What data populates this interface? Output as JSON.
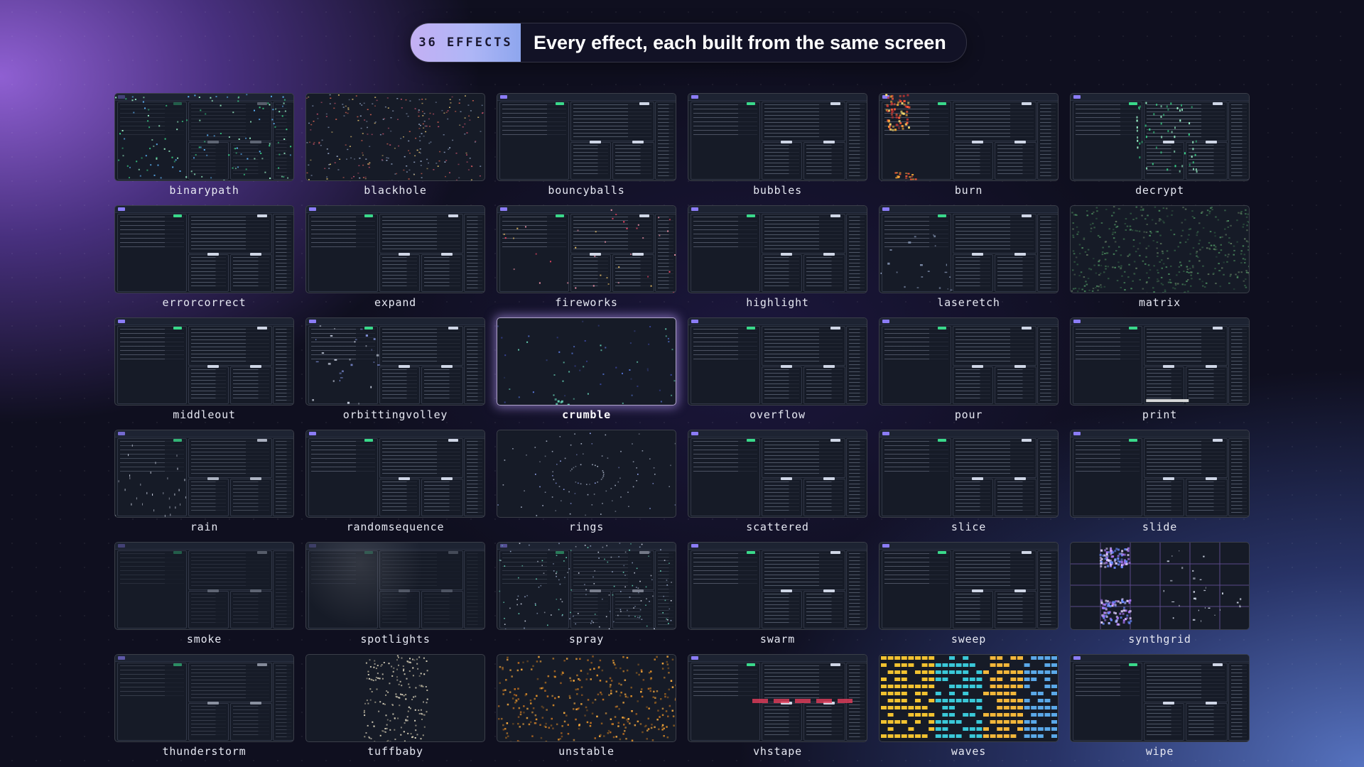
{
  "header": {
    "badge": "36 EFFECTS",
    "title": "Every effect, each built from the same screen"
  },
  "colors": {
    "badge_gradient": [
      "#c4b0f4",
      "#8ea6ee"
    ],
    "screen_bg": "#161b27",
    "accent_green": "#39d98a",
    "accent_purple": "#8b7cf6"
  },
  "selected_effect": "crumble",
  "effects": [
    {
      "name": "binarypath",
      "style": "binarypath"
    },
    {
      "name": "blackhole",
      "style": "blackhole"
    },
    {
      "name": "bouncyballs",
      "style": "term"
    },
    {
      "name": "bubbles",
      "style": "term"
    },
    {
      "name": "burn",
      "style": "burn"
    },
    {
      "name": "decrypt",
      "style": "decrypt"
    },
    {
      "name": "errorcorrect",
      "style": "term"
    },
    {
      "name": "expand",
      "style": "term"
    },
    {
      "name": "fireworks",
      "style": "fireworks"
    },
    {
      "name": "highlight",
      "style": "term"
    },
    {
      "name": "laseretch",
      "style": "laser"
    },
    {
      "name": "matrix",
      "style": "matrix"
    },
    {
      "name": "middleout",
      "style": "term"
    },
    {
      "name": "orbittingvolley",
      "style": "sparse"
    },
    {
      "name": "crumble",
      "style": "crumble"
    },
    {
      "name": "overflow",
      "style": "term"
    },
    {
      "name": "pour",
      "style": "term"
    },
    {
      "name": "print",
      "style": "print"
    },
    {
      "name": "rain",
      "style": "rain"
    },
    {
      "name": "randomsequence",
      "style": "term"
    },
    {
      "name": "rings",
      "style": "rings"
    },
    {
      "name": "scattered",
      "style": "term"
    },
    {
      "name": "slice",
      "style": "term"
    },
    {
      "name": "slide",
      "style": "term"
    },
    {
      "name": "smoke",
      "style": "smoke"
    },
    {
      "name": "spotlights",
      "style": "spot"
    },
    {
      "name": "spray",
      "style": "spray"
    },
    {
      "name": "swarm",
      "style": "term"
    },
    {
      "name": "sweep",
      "style": "term"
    },
    {
      "name": "synthgrid",
      "style": "synth"
    },
    {
      "name": "thunderstorm",
      "style": "storm"
    },
    {
      "name": "tuffbaby",
      "style": "tuff"
    },
    {
      "name": "unstable",
      "style": "unstable"
    },
    {
      "name": "vhstape",
      "style": "vhs"
    },
    {
      "name": "waves",
      "style": "waves"
    },
    {
      "name": "wipe",
      "style": "term"
    }
  ]
}
